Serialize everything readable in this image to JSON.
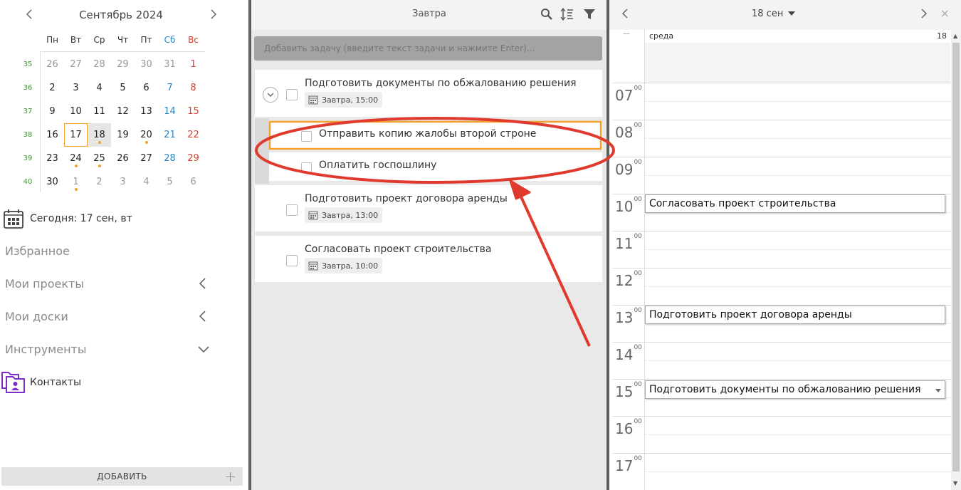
{
  "calendar": {
    "month_title": "Сентябрь 2024",
    "prev_label": "‹",
    "next_label": "›",
    "weekdays": [
      "Пн",
      "Вт",
      "Ср",
      "Чт",
      "Пт",
      "Сб",
      "Вс"
    ],
    "week_numbers": [
      "35",
      "36",
      "37",
      "38",
      "39",
      "40"
    ],
    "weeks": [
      [
        "26",
        "27",
        "28",
        "29",
        "30",
        "31",
        "1"
      ],
      [
        "2",
        "3",
        "4",
        "5",
        "6",
        "7",
        "8"
      ],
      [
        "9",
        "10",
        "11",
        "12",
        "13",
        "14",
        "15"
      ],
      [
        "16",
        "17",
        "18",
        "19",
        "20",
        "21",
        "22"
      ],
      [
        "23",
        "24",
        "25",
        "26",
        "27",
        "28",
        "29"
      ],
      [
        "30",
        "1",
        "2",
        "3",
        "4",
        "5",
        "6"
      ]
    ]
  },
  "sidebar": {
    "today_label": "Сегодня: 17 сен, вт",
    "favorites": "Избранное",
    "my_projects": "Мои проекты",
    "my_boards": "Мои доски",
    "tools": "Инструменты",
    "contacts": "Контакты",
    "add_button": "ДОБАВИТЬ",
    "add_plus": "+"
  },
  "tasks_panel": {
    "title": "Завтра",
    "add_placeholder": "Добавить задачу (введите текст задачи и нажмите Enter)...",
    "tasks": [
      {
        "title": "Подготовить документы по обжалованию решения",
        "date": "Завтра, 15:00"
      },
      {
        "title": "Подготовить проект договора аренды",
        "date": "Завтра, 13:00"
      },
      {
        "title": "Согласовать проект строительства",
        "date": "Завтра, 10:00"
      }
    ],
    "subtasks": [
      {
        "title": "Отправить копию жалобы второй строне"
      },
      {
        "title": "Оплатить госпошлину"
      }
    ]
  },
  "day_view": {
    "date_label": "18 сен",
    "prev_label": "‹",
    "next_label": "›",
    "close_label": "×",
    "allday_dash": "—",
    "weekday": "среда",
    "day_number": "18",
    "hours": [
      "07",
      "08",
      "09",
      "10",
      "11",
      "12",
      "13",
      "14",
      "15",
      "16",
      "17"
    ],
    "minutes_label": "00",
    "events": [
      {
        "title": "Согласовать проект строительства",
        "hour": "10"
      },
      {
        "title": "Подготовить проект договора аренды",
        "hour": "13"
      },
      {
        "title": "Подготовить документы по обжалованию решения",
        "hour": "15"
      }
    ]
  },
  "colors": {
    "accent_orange": "#f2a030",
    "annotation_red": "#e03a2e",
    "weekend_saturday": "#2b86c5",
    "weekend_sunday": "#e23a2a",
    "week_number_green": "#3a9b2a",
    "contacts_icon": "#7b2fc9"
  },
  "icons": {
    "tasks_header": [
      "search-icon",
      "sort-icon",
      "filter-icon"
    ],
    "today": "calendar-icon",
    "contacts": "contacts-icon"
  }
}
